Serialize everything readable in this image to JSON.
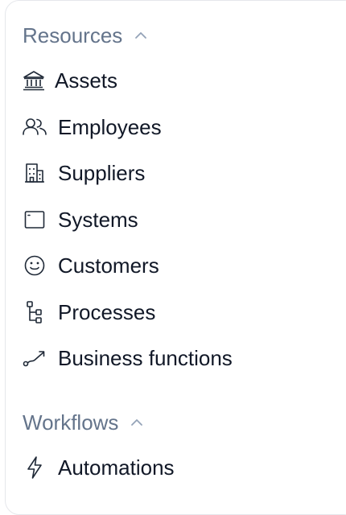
{
  "resources": {
    "title": "Resources",
    "items": [
      {
        "label": "Assets",
        "icon": "bank-icon"
      },
      {
        "label": "Employees",
        "icon": "users-icon"
      },
      {
        "label": "Suppliers",
        "icon": "building-icon"
      },
      {
        "label": "Systems",
        "icon": "window-icon"
      },
      {
        "label": "Customers",
        "icon": "smiley-icon"
      },
      {
        "label": "Processes",
        "icon": "process-tree-icon"
      },
      {
        "label": "Business functions",
        "icon": "trend-arrow-icon"
      }
    ]
  },
  "workflows": {
    "title": "Workflows",
    "items": [
      {
        "label": "Automations",
        "icon": "lightning-icon"
      }
    ]
  },
  "colors": {
    "section_header": "#64748b",
    "item_text": "#111827",
    "icon_stroke": "#1f2937",
    "border": "#e5e7eb"
  }
}
